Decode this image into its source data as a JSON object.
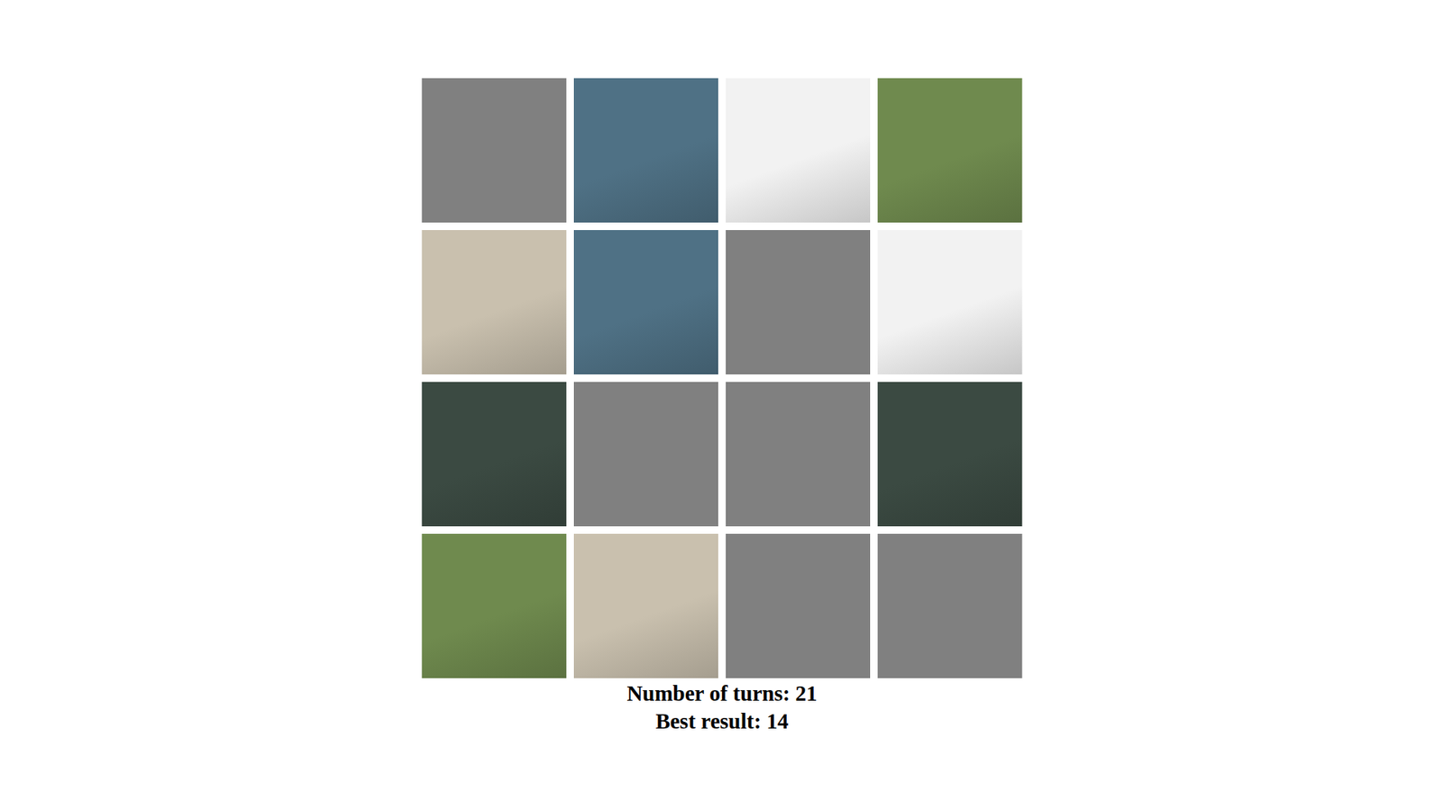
{
  "cards": [
    {
      "flipped": false
    },
    {
      "flipped": true,
      "color": "#4f7185"
    },
    {
      "flipped": true,
      "color": "#f2f2f2"
    },
    {
      "flipped": true,
      "color": "#6f8a4e"
    },
    {
      "flipped": true,
      "color": "#c9c0ae"
    },
    {
      "flipped": true,
      "color": "#4f7185"
    },
    {
      "flipped": false
    },
    {
      "flipped": true,
      "color": "#f2f2f2"
    },
    {
      "flipped": true,
      "color": "#3b4a42"
    },
    {
      "flipped": false
    },
    {
      "flipped": false
    },
    {
      "flipped": true,
      "color": "#3b4a42"
    },
    {
      "flipped": true,
      "color": "#6f8a4e"
    },
    {
      "flipped": true,
      "color": "#c9c0ae"
    },
    {
      "flipped": false
    },
    {
      "flipped": false
    }
  ],
  "stats": [
    {
      "label": "Number of turns:",
      "value": "21"
    },
    {
      "label": "Best result:",
      "value": "14"
    }
  ]
}
